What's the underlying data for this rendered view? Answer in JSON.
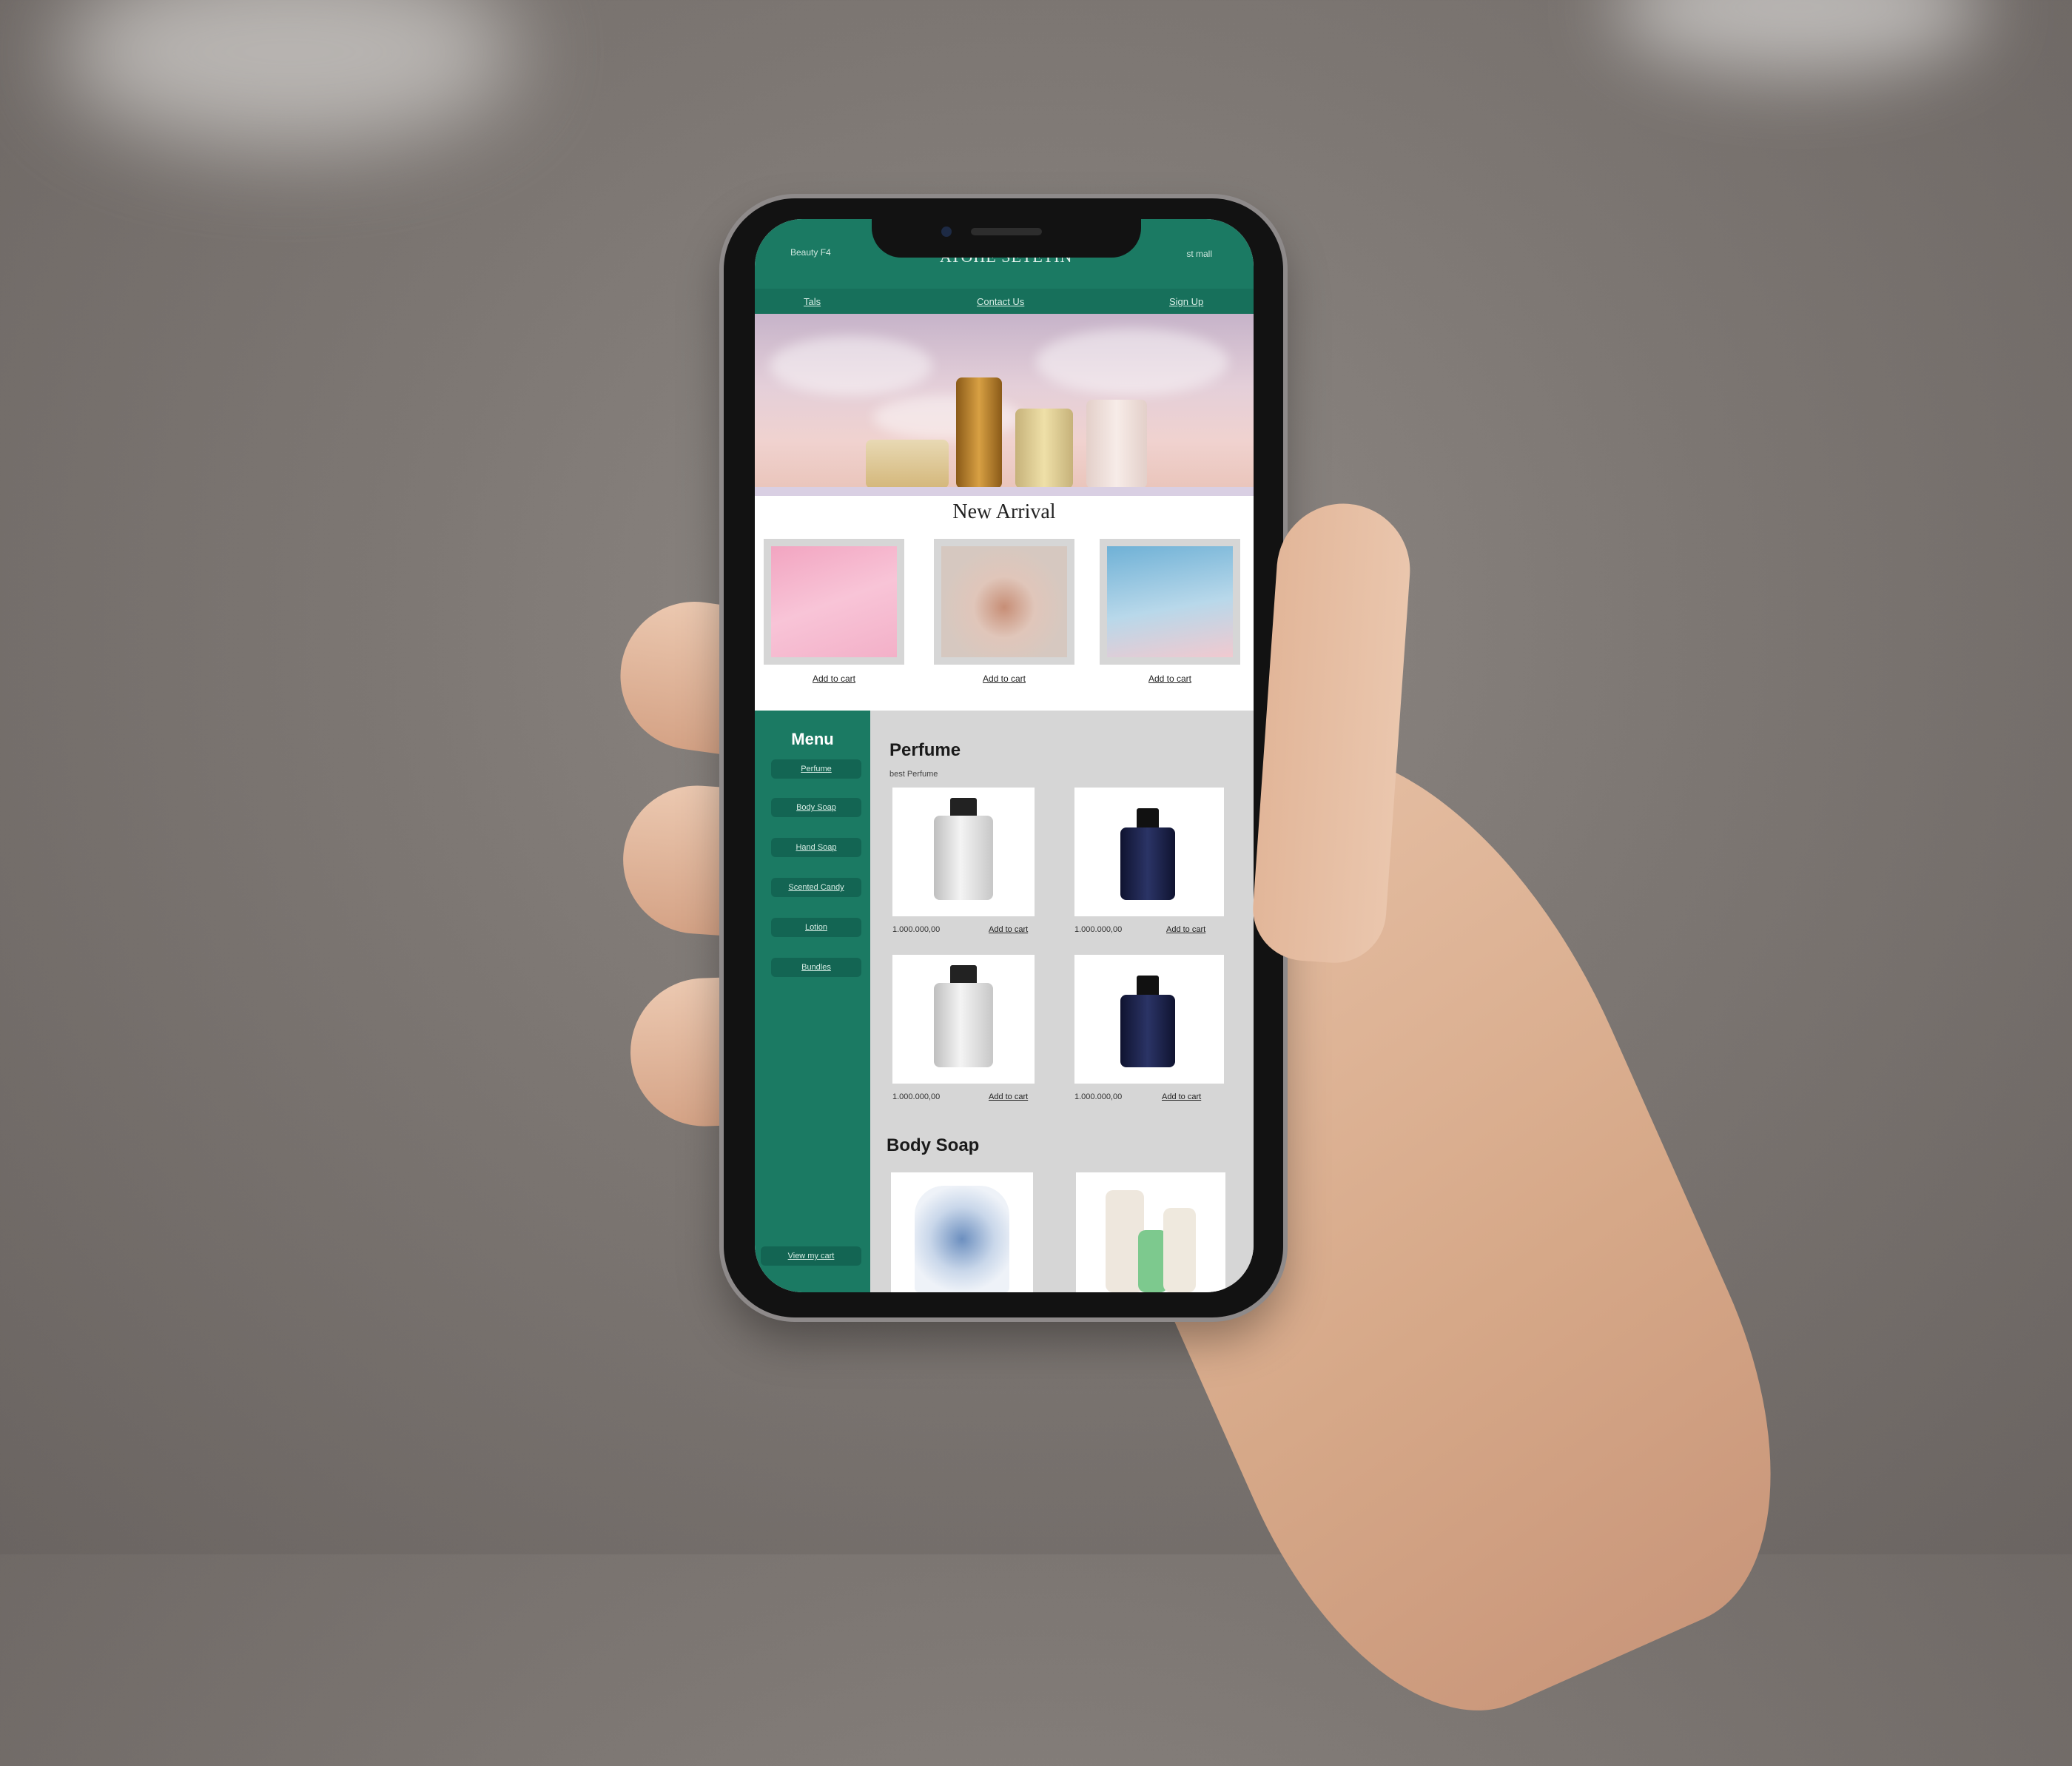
{
  "store": {
    "brand": "ATOHE SETETIN",
    "header_left": "Beauty F4",
    "header_right": "st mall"
  },
  "nav": [
    "Tals",
    "Contact Us",
    "Sign Up"
  ],
  "new_arrival": {
    "title": "New Arrival",
    "items": [
      {
        "action": "Add to cart"
      },
      {
        "action": "Add to cart"
      },
      {
        "action": "Add to cart"
      }
    ]
  },
  "menu": {
    "title": "Menu",
    "items": [
      "Perfume",
      "Body Soap",
      "Hand Soap",
      "Scented Candy",
      "Lotion",
      "Bundles"
    ],
    "view_cart": "View my cart"
  },
  "sections": {
    "perfume": {
      "title": "Perfume",
      "subtitle": "best Perfume",
      "products": [
        {
          "price": "1.000.000,00",
          "action": "Add to cart"
        },
        {
          "price": "1.000.000,00",
          "action": "Add to cart"
        },
        {
          "price": "1.000.000,00",
          "action": "Add to cart"
        },
        {
          "price": "1.000.000,00",
          "action": "Add to cart"
        }
      ]
    },
    "body_soap": {
      "title": "Body Soap"
    }
  },
  "colors": {
    "primary": "#1b7a63",
    "primary_dark": "#136553",
    "content_bg": "#d6d6d6"
  }
}
